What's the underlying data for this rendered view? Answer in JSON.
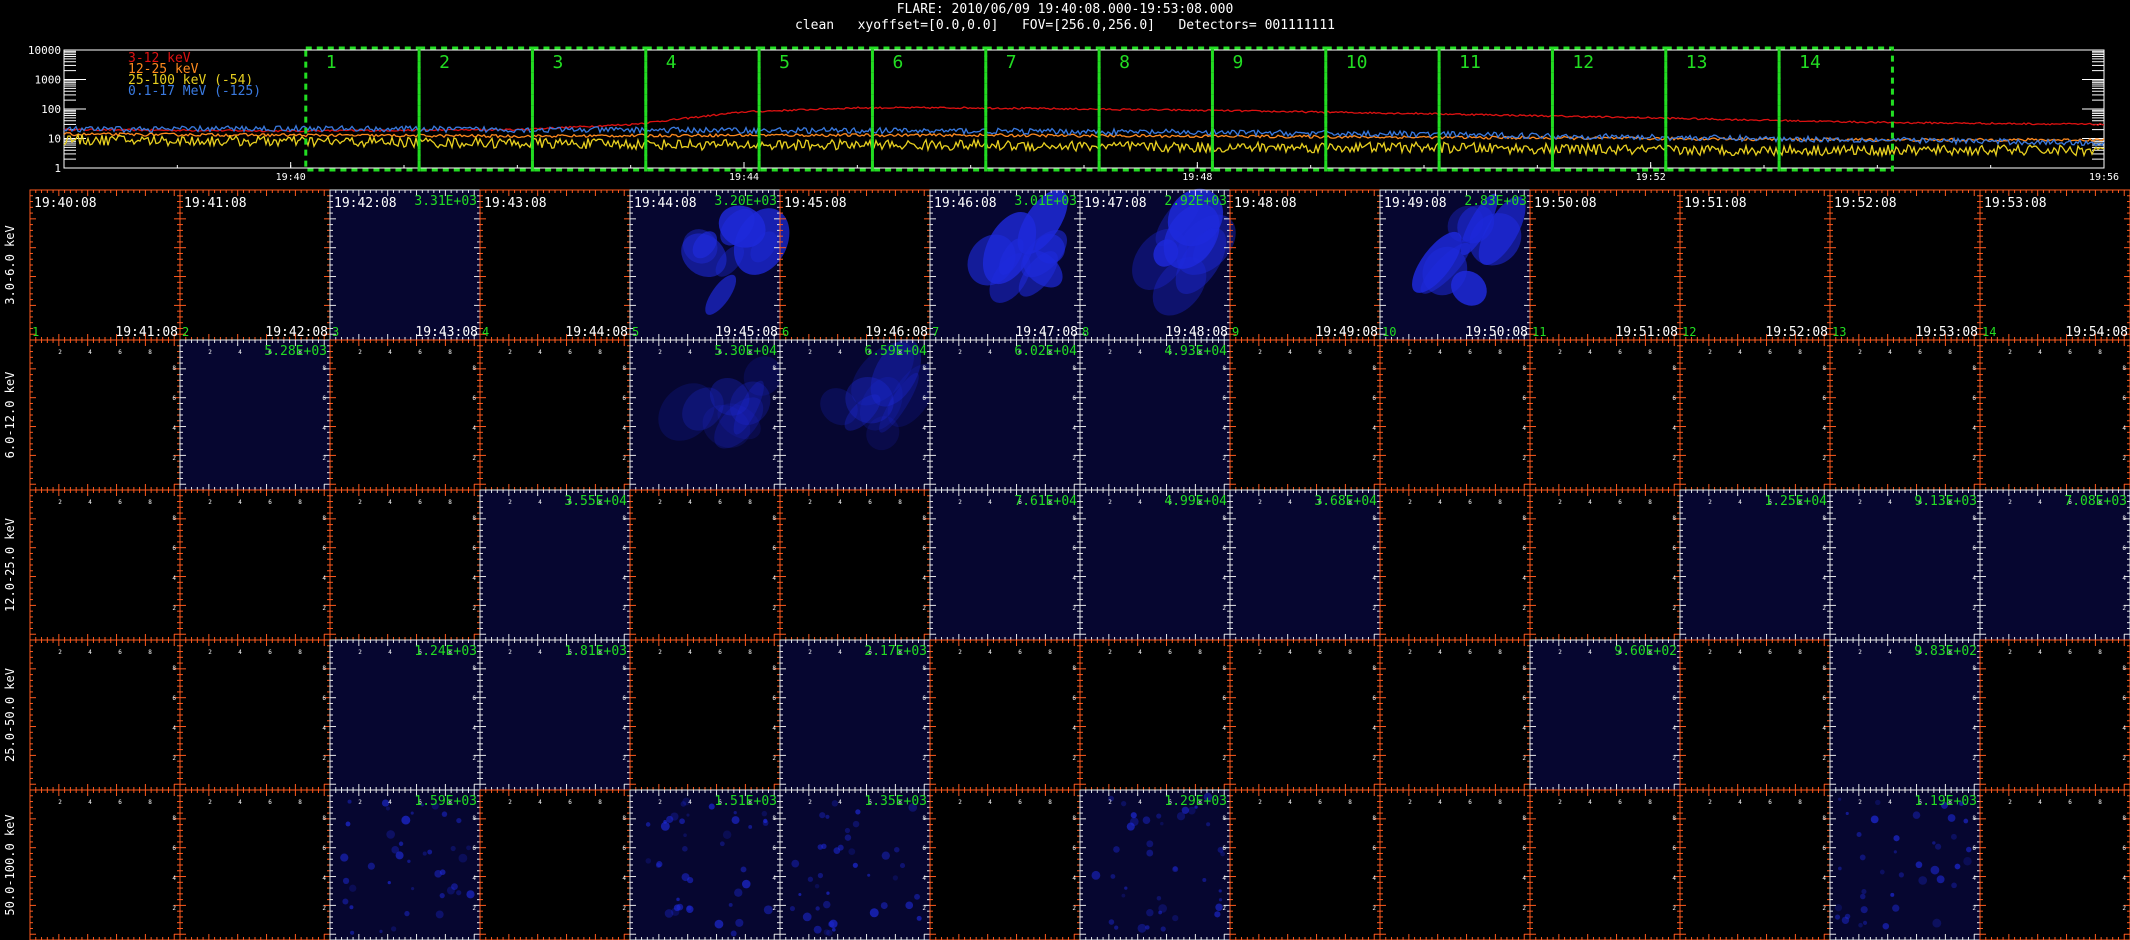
{
  "header": {
    "title": "FLARE: 2010/06/09 19:40:08.000-19:53:08.000",
    "subtitle": "clean   xyoffset=[0.0,0.0]   FOV=[256.0,256.0]   Detectors= 001111111"
  },
  "colors": {
    "background": "#000000",
    "box_green": "#22dd22",
    "frame_orange": "#ff5a1e",
    "frame_white": "#e8e8e8",
    "peak_green": "#22dd22",
    "image_bg": "#060630",
    "source_blue": "#1e2adc"
  },
  "chart_data": [
    {
      "type": "line",
      "yscale": "log",
      "ylim": [
        1,
        10000
      ],
      "ytick_labels": [
        "10000",
        "1000",
        "100",
        "10",
        "1"
      ],
      "xlim": [
        "19:38",
        "19:56"
      ],
      "xtick_labels": [
        "19:40",
        "19:44",
        "19:48",
        "19:52",
        "19:56"
      ],
      "grid": false,
      "legend_placement": "top-left",
      "time_intervals": [
        "1",
        "2",
        "3",
        "4",
        "5",
        "6",
        "7",
        "8",
        "9",
        "10",
        "11",
        "12",
        "13",
        "14"
      ],
      "interval_start": "19:40:08",
      "interval_end": "19:53:08",
      "series": [
        {
          "name": "3-12 keV",
          "color": "#dd1111",
          "x": [
            "19:38",
            "19:40",
            "19:42",
            "19:43",
            "19:44",
            "19:45",
            "19:46",
            "19:48",
            "19:50",
            "19:52",
            "19:54",
            "19:56"
          ],
          "values": [
            20,
            18,
            20,
            30,
            80,
            110,
            110,
            90,
            70,
            50,
            35,
            30
          ]
        },
        {
          "name": "12-25 keV",
          "color": "#ff8a1e",
          "x": [
            "19:38",
            "19:40",
            "19:42",
            "19:44",
            "19:46",
            "19:48",
            "19:50",
            "19:52",
            "19:54",
            "19:56"
          ],
          "values": [
            14,
            13,
            12,
            13,
            13,
            12,
            11,
            10,
            9,
            9
          ]
        },
        {
          "name": "25-100 keV (-54)",
          "color": "#e8d020",
          "x": [
            "19:38",
            "19:40",
            "19:42",
            "19:44",
            "19:46",
            "19:48",
            "19:50",
            "19:52",
            "19:54",
            "19:56"
          ],
          "values": [
            9,
            8,
            7,
            6,
            6,
            5,
            5,
            4,
            4,
            4
          ]
        },
        {
          "name": "0.1-17 MeV (-125)",
          "color": "#3a7ae0",
          "x": [
            "19:38",
            "19:40",
            "19:42",
            "19:44",
            "19:46",
            "19:48",
            "19:50",
            "19:52",
            "19:54",
            "19:56"
          ],
          "values": [
            20,
            22,
            20,
            19,
            18,
            16,
            14,
            11,
            9,
            7
          ]
        }
      ]
    },
    {
      "type": "heatmap",
      "row_labels": [
        "3.0-6.0 keV",
        "6.0-12.0 keV",
        "12.0-25.0 keV",
        "25.0-50.0 keV",
        "50.0-100.0 keV"
      ],
      "col_start_times": [
        "19:40:08",
        "19:41:08",
        "19:42:08",
        "19:43:08",
        "19:44:08",
        "19:45:08",
        "19:46:08",
        "19:47:08",
        "19:48:08",
        "19:49:08",
        "19:50:08",
        "19:51:08",
        "19:52:08",
        "19:53:08"
      ],
      "col_end_times": [
        "19:41:08",
        "19:42:08",
        "19:43:08",
        "19:44:08",
        "19:45:08",
        "19:46:08",
        "19:47:08",
        "19:48:08",
        "19:49:08",
        "19:50:08",
        "19:51:08",
        "19:52:08",
        "19:53:08",
        "19:54:08"
      ],
      "col_numbers": [
        "1",
        "2",
        "3",
        "4",
        "5",
        "6",
        "7",
        "8",
        "9",
        "10",
        "11",
        "12",
        "13",
        "14"
      ],
      "axis_tick_labels": [
        "2",
        "4",
        "6",
        "8"
      ],
      "cells": [
        {
          "row": 0,
          "col": 2,
          "peak": "3.31E+03"
        },
        {
          "row": 0,
          "col": 4,
          "peak": "3.20E+03",
          "source": "strong"
        },
        {
          "row": 0,
          "col": 6,
          "peak": "3.01E+03",
          "source": "strong"
        },
        {
          "row": 0,
          "col": 7,
          "peak": "2.92E+03",
          "source": "strong"
        },
        {
          "row": 0,
          "col": 9,
          "peak": "2.83E+03",
          "source": "strong"
        },
        {
          "row": 1,
          "col": 1,
          "peak": "5.28E+03"
        },
        {
          "row": 1,
          "col": 4,
          "peak": "5.30E+04",
          "source": "weak"
        },
        {
          "row": 1,
          "col": 5,
          "peak": "6.59E+04",
          "source": "weak"
        },
        {
          "row": 1,
          "col": 6,
          "peak": "6.02E+04"
        },
        {
          "row": 1,
          "col": 7,
          "peak": "4.93E+04"
        },
        {
          "row": 2,
          "col": 3,
          "peak": "3.55E+04"
        },
        {
          "row": 2,
          "col": 6,
          "peak": "7.61E+04"
        },
        {
          "row": 2,
          "col": 7,
          "peak": "4.99E+04"
        },
        {
          "row": 2,
          "col": 8,
          "peak": "3.68E+04"
        },
        {
          "row": 2,
          "col": 11,
          "peak": "1.25E+04"
        },
        {
          "row": 2,
          "col": 12,
          "peak": "9.13E+03"
        },
        {
          "row": 2,
          "col": 13,
          "peak": "7.08E+03"
        },
        {
          "row": 3,
          "col": 2,
          "peak": "1.24E+03"
        },
        {
          "row": 3,
          "col": 3,
          "peak": "1.81E+03"
        },
        {
          "row": 3,
          "col": 5,
          "peak": "2.17E+03"
        },
        {
          "row": 3,
          "col": 10,
          "peak": "9.60E+02"
        },
        {
          "row": 3,
          "col": 12,
          "peak": "9.83E+02"
        },
        {
          "row": 4,
          "col": 2,
          "peak": "1.59E+03",
          "source": "speckle"
        },
        {
          "row": 4,
          "col": 4,
          "peak": "1.51E+03",
          "source": "speckle"
        },
        {
          "row": 4,
          "col": 5,
          "peak": "1.35E+03",
          "source": "speckle"
        },
        {
          "row": 4,
          "col": 7,
          "peak": "1.29E+03",
          "source": "speckle"
        },
        {
          "row": 4,
          "col": 12,
          "peak": "1.19E+03",
          "source": "speckle"
        }
      ]
    }
  ]
}
